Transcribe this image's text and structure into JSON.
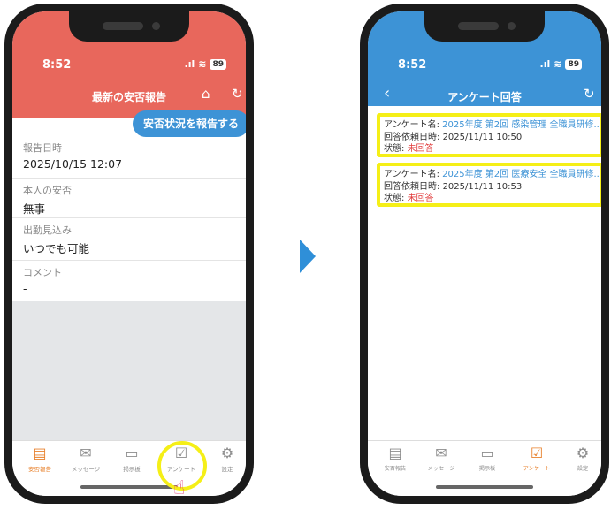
{
  "left_screen": {
    "status": {
      "time": "8:52",
      "battery": "89"
    },
    "header": {
      "title": "最新の安否報告"
    },
    "report_button": "安否状況を報告する",
    "fields": [
      {
        "label": "報告日時",
        "value": "2025/10/15 12:07"
      },
      {
        "label": "本人の安否",
        "value": "無事"
      },
      {
        "label": "出勤見込み",
        "value": "いつでも可能"
      },
      {
        "label": "コメント",
        "value": "-"
      }
    ],
    "tabs": [
      {
        "label": "安否報告",
        "icon": "clipboard-icon",
        "active": true
      },
      {
        "label": "メッセージ",
        "icon": "mail-icon",
        "active": false
      },
      {
        "label": "掲示板",
        "icon": "board-icon",
        "active": false
      },
      {
        "label": "アンケート",
        "icon": "survey-icon",
        "active": false
      },
      {
        "label": "設定",
        "icon": "gear-icon",
        "active": false
      }
    ]
  },
  "right_screen": {
    "status": {
      "time": "8:52",
      "battery": "89"
    },
    "header": {
      "title": "アンケート回答"
    },
    "surveys": [
      {
        "name_label": "アンケート名: ",
        "name": "2025年度 第2回 感染管理 全職員研修...",
        "date_label": "回答依頼日時: ",
        "date": "2025/11/11 10:50",
        "state_label": "状態: ",
        "state": "未回答"
      },
      {
        "name_label": "アンケート名: ",
        "name": "2025年度 第2回 医療安全 全職員研修...",
        "date_label": "回答依頼日時: ",
        "date": "2025/11/11 10:53",
        "state_label": "状態: ",
        "state": "未回答"
      }
    ],
    "tabs": [
      {
        "label": "安否報告",
        "icon": "clipboard-icon",
        "active": false
      },
      {
        "label": "メッセージ",
        "icon": "mail-icon",
        "active": false
      },
      {
        "label": "掲示板",
        "icon": "board-icon",
        "active": false
      },
      {
        "label": "アンケート",
        "icon": "survey-icon",
        "active": true
      },
      {
        "label": "設定",
        "icon": "gear-icon",
        "active": false
      }
    ]
  },
  "colors": {
    "left_header": "#e8675c",
    "right_header": "#3d93d6",
    "highlight": "#f5ef17",
    "active_tab": "#e8822e",
    "unanswered": "#e03a3a"
  }
}
